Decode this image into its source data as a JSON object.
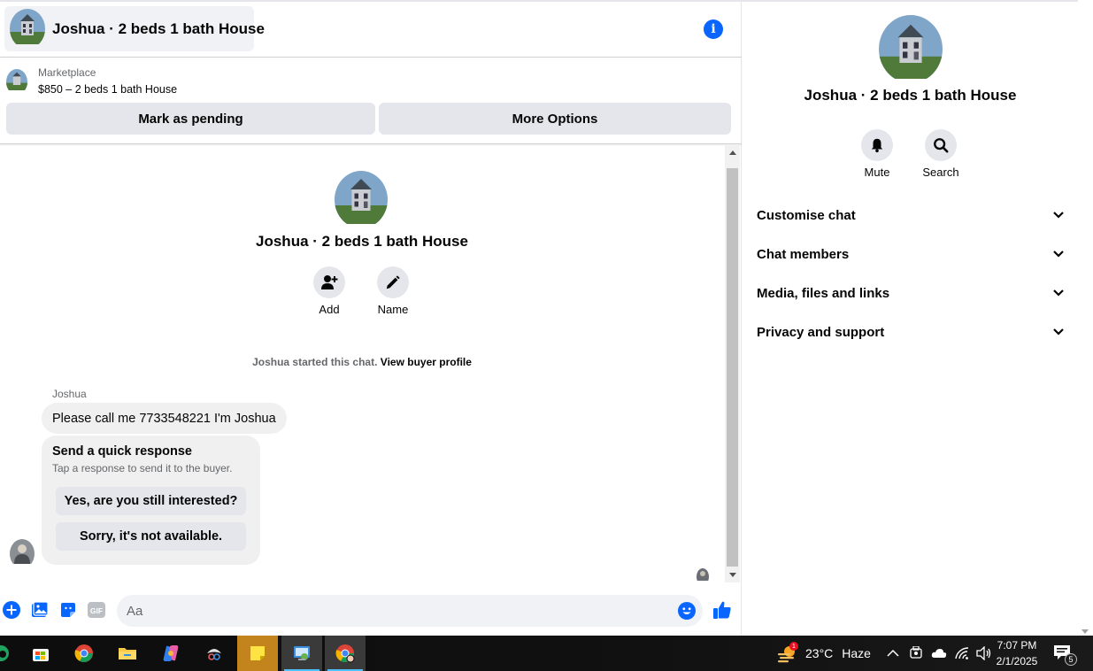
{
  "header": {
    "title": "Joshua · 2 beds 1 bath House",
    "info_icon": "i"
  },
  "marketplace": {
    "label": "Marketplace",
    "listing": "$850 – 2 beds 1 bath House",
    "mark_pending": "Mark as pending",
    "more_options": "More Options"
  },
  "thread": {
    "title": "Joshua · 2 beds 1 bath House",
    "actions": [
      {
        "label": "Add",
        "icon": "person-add-icon"
      },
      {
        "label": "Name",
        "icon": "pencil-icon"
      }
    ],
    "started_text": "Joshua started this chat.",
    "view_profile": "View buyer profile",
    "sender": "Joshua",
    "message": "Please call me 7733548221 I'm Joshua",
    "quick_response": {
      "title": "Send a quick response",
      "subtitle": "Tap a response to send it to the buyer.",
      "options": [
        "Yes, are you still interested?",
        "Sorry, it's not available."
      ]
    }
  },
  "composer": {
    "placeholder": "Aa",
    "icons": [
      "plus-circle-icon",
      "photo-icon",
      "sticker-icon",
      "gif-icon",
      "emoji-icon",
      "thumbs-up-icon"
    ],
    "gif_label": "GIF"
  },
  "info_panel": {
    "title": "Joshua · 2 beds 1 bath House",
    "actions": [
      {
        "label": "Mute",
        "icon": "bell-icon"
      },
      {
        "label": "Search",
        "icon": "search-icon"
      }
    ],
    "sections": [
      "Customise chat",
      "Chat members",
      "Media, files and links",
      "Privacy and support"
    ]
  },
  "taskbar": {
    "weather_temp": "23°C",
    "weather_desc": "Haze",
    "weather_alert": "1",
    "time": "7:07 PM",
    "date": "2/1/2025",
    "notifications": "5"
  },
  "colors": {
    "accent": "#0866ff",
    "surface": "#f0f2f5",
    "button": "#e4e6eb"
  }
}
